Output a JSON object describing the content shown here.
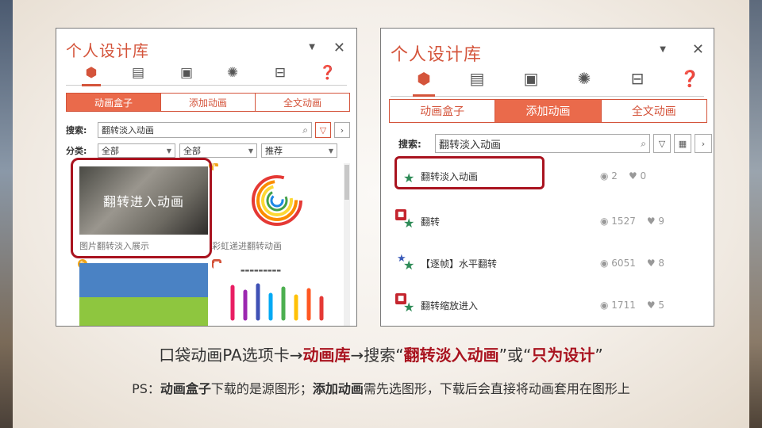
{
  "panel_left": {
    "title": "个人设计库",
    "tabs": [
      "动画盒子",
      "添加动画",
      "全文动画"
    ],
    "search_label": "搜索:",
    "search_value": "翻转淡入动画",
    "category_label": "分类:",
    "selects": [
      "全部",
      "全部",
      "推荐"
    ],
    "cards": [
      {
        "overlay": "翻转进入动画",
        "caption": "图片翻转淡入展示"
      },
      {
        "caption": "彩虹递进翻转动画"
      },
      {},
      {}
    ]
  },
  "panel_right": {
    "title": "个人设计库",
    "tabs": [
      "动画盒子",
      "添加动画",
      "全文动画"
    ],
    "search_label": "搜索:",
    "search_value": "翻转淡入动画",
    "items": [
      {
        "name": "翻转淡入动画",
        "views": "2",
        "likes": "0"
      },
      {
        "name": "翻转",
        "views": "1527",
        "likes": "9"
      },
      {
        "name": "【逐帧】水平翻转",
        "views": "6051",
        "likes": "8"
      },
      {
        "name": "翻转缩放进入",
        "views": "1711",
        "likes": "5"
      }
    ]
  },
  "caption_line1": {
    "p1": "口袋动画PA选项卡→",
    "e1": "动画库",
    "p2": "→搜索“",
    "e2": "翻转淡入动画",
    "p3": "”或“",
    "e3": "只为设计",
    "p4": "”"
  },
  "caption_line2": {
    "p1": "PS：",
    "b1": "动画盒子",
    "p2": "下载的是源图形；",
    "b2": "添加动画",
    "p3": "需先选图形，下载后会直接将动画套用在图形上"
  },
  "colors": {
    "accent": "#d4543b",
    "highlight": "#a9131f"
  }
}
